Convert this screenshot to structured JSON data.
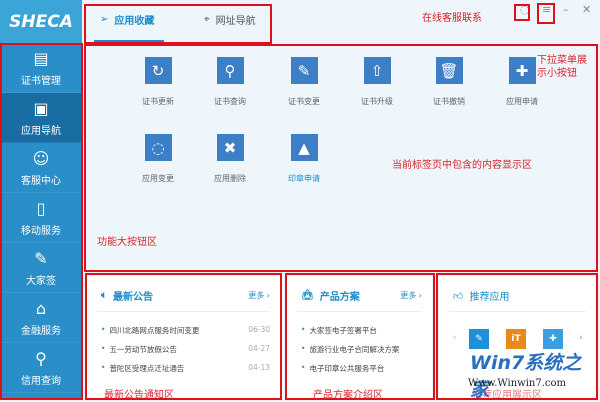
{
  "logo": "SHECA",
  "sidebar": {
    "items": [
      {
        "label": "证书管理",
        "icon": "certificate-icon"
      },
      {
        "label": "应用导航",
        "icon": "grid-icon"
      },
      {
        "label": "客服中心",
        "icon": "user-icon"
      },
      {
        "label": "移动服务",
        "icon": "phone-icon"
      },
      {
        "label": "大家签",
        "icon": "sign-icon"
      },
      {
        "label": "金融服务",
        "icon": "bank-icon"
      },
      {
        "label": "信用查询",
        "icon": "search-icon"
      }
    ],
    "active": 1
  },
  "tabs": [
    {
      "label": "应用收藏",
      "icon": "send-icon"
    },
    {
      "label": "网址导航",
      "icon": "location-icon"
    }
  ],
  "apps": [
    {
      "label": "证书更新",
      "icon": "refresh-icon"
    },
    {
      "label": "证书查询",
      "icon": "search-icon"
    },
    {
      "label": "证书变更",
      "icon": "edit-icon"
    },
    {
      "label": "证书升级",
      "icon": "upgrade-icon"
    },
    {
      "label": "证书撤销",
      "icon": "trash-icon"
    },
    {
      "label": "应用申请",
      "icon": "puzzle-icon"
    },
    {
      "label": "应用变更",
      "icon": "loading-icon"
    },
    {
      "label": "应用删除",
      "icon": "cart-delete-icon"
    },
    {
      "label": "印章申请",
      "icon": "stamp-icon"
    }
  ],
  "notices": {
    "title": "最新公告",
    "more": "更多 ›",
    "items": [
      {
        "text": "四川北路网点服务时间变更",
        "date": "06-30"
      },
      {
        "text": "五一劳动节放假公告",
        "date": "04-27"
      },
      {
        "text": "普陀区受理点迁址通告",
        "date": "04-13"
      }
    ]
  },
  "products": {
    "title": "产品方案",
    "more": "更多 ›",
    "items": [
      "大家签电子签署平台",
      "旅游行业电子合同解决方案",
      "电子印章公共服务平台"
    ]
  },
  "recommend": {
    "title": "推荐应用",
    "items": [
      "✎",
      "iT",
      "✚"
    ]
  },
  "annotations": {
    "online": "在线客服联系",
    "menu1": "下拉菜单展",
    "menu2": "示小按钮",
    "content": "当前标签页中包含的内容显示区",
    "func": "功能大按钮区",
    "notice": "最新公告通知区",
    "product": "产品方案介绍区",
    "recommend": "推荐应用展示区"
  },
  "watermark": {
    "title": "Win7系统之家",
    "url": "Www.Winwin7.com"
  },
  "colors": {
    "accent": "#1d8ccc",
    "annotation": "#e0101a",
    "tile": "#3d7fc6"
  }
}
